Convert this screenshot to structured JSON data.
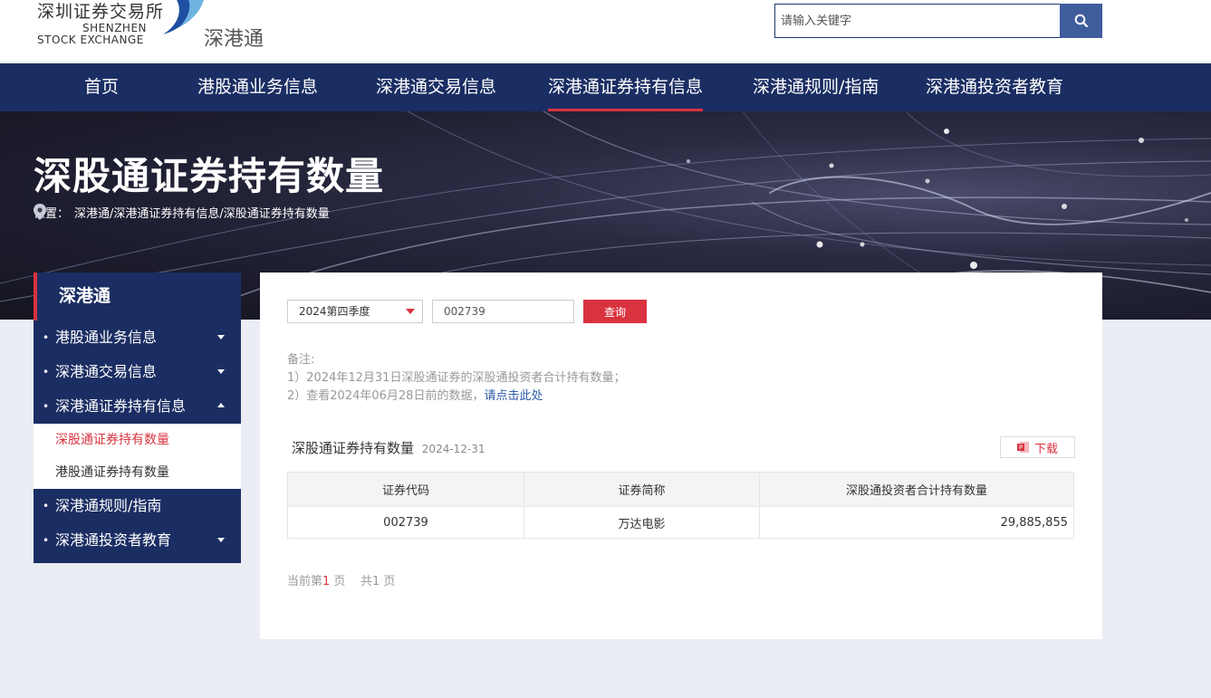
{
  "header": {
    "logo_cn": "深圳证券交易所",
    "logo_en_1": "SHENZHEN",
    "logo_en_2": "STOCK EXCHANGE",
    "site_name": "深港通",
    "search_placeholder": "请输入关键字",
    "search_icon": "search-icon"
  },
  "nav": {
    "items": [
      {
        "label": "首页"
      },
      {
        "label": "港股通业务信息"
      },
      {
        "label": "深港通交易信息"
      },
      {
        "label": "深港通证券持有信息",
        "active": true
      },
      {
        "label": "深港通规则/指南"
      },
      {
        "label": "深港通投资者教育"
      }
    ]
  },
  "banner": {
    "title": "深股通证券持有数量",
    "breadcrumb_label": "位置：",
    "breadcrumb_path": "深港通/深港通证券持有信息/深股通证券持有数量"
  },
  "sidebar": {
    "title": "深港通",
    "items": [
      {
        "label": "港股通业务信息"
      },
      {
        "label": "深港通交易信息"
      },
      {
        "label": "深港通证券持有信息",
        "expanded": true
      },
      {
        "label": "深港通规则/指南"
      },
      {
        "label": "深港通投资者教育"
      }
    ],
    "sub_items": [
      {
        "label": "深股通证券持有数量",
        "active": true
      },
      {
        "label": "港股通证券持有数量"
      }
    ]
  },
  "filters": {
    "period": "2024第四季度",
    "code": "002739",
    "query_label": "查询"
  },
  "notes": {
    "title": "备注:",
    "line1": "1）2024年12月31日深股通证券的深股通投资者合计持有数量；",
    "line2_prefix": "2）查看2024年06月28日前的数据，",
    "line2_link": "请点击此处"
  },
  "table": {
    "title": "深股通证券持有数量",
    "date": "2024-12-31",
    "download_label": "下载",
    "headers": [
      "证券代码",
      "证券简称",
      "深股通投资者合计持有数量"
    ],
    "rows": [
      [
        "002739",
        "万达电影",
        "29,885,855"
      ]
    ]
  },
  "pager": {
    "prefix": "当前第",
    "current": "1",
    "suffix": " 页",
    "total_prefix": "共",
    "total": "1",
    "total_suffix": " 页"
  },
  "colors": {
    "nav_bg": "#1b2e63",
    "accent_red": "#d9333f",
    "search_btn": "#3f5d9d",
    "link_blue": "#2f5da8"
  }
}
